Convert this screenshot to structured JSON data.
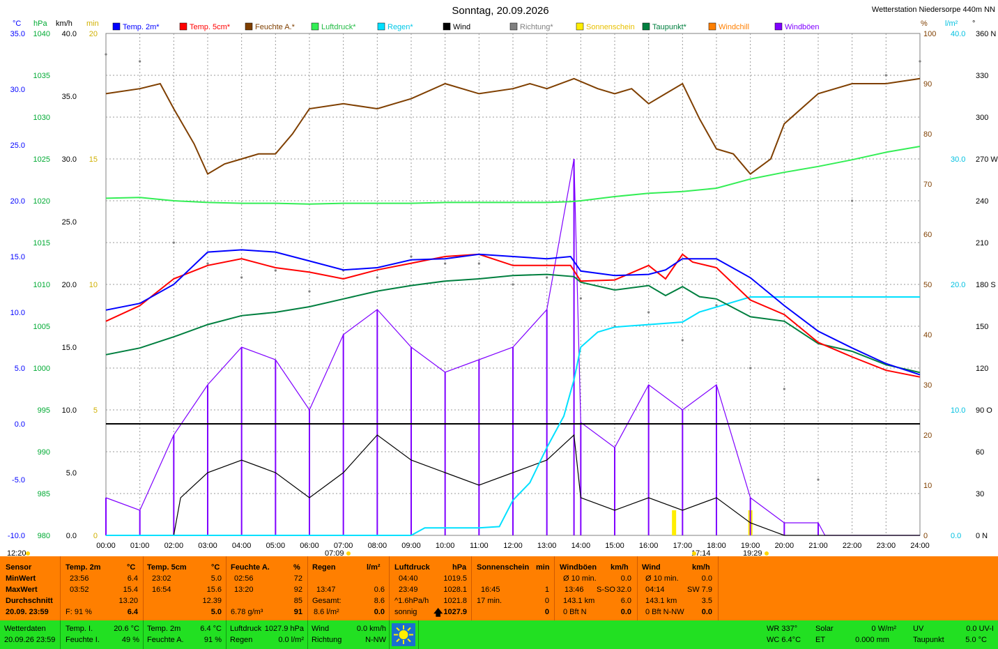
{
  "title": "Sonntag, 20.09.2026",
  "station": "Wetterstation Niedersorpe 440m NN",
  "legend": [
    {
      "label": "Temp. 2m*",
      "color": "#0000ff"
    },
    {
      "label": "Temp. 5cm*",
      "color": "#ff0000"
    },
    {
      "label": "Feuchte A.*",
      "color": "#7f3f00"
    },
    {
      "label": "Luftdruck*",
      "color": "#33ee55"
    },
    {
      "label": "Regen*",
      "color": "#00e0ff"
    },
    {
      "label": "Wind",
      "color": "#000000"
    },
    {
      "label": "Richtung*",
      "color": "#808080"
    },
    {
      "label": "Sonnenschein",
      "color": "#ffee00"
    },
    {
      "label": "Taupunkt*",
      "color": "#007f3f"
    },
    {
      "label": "Windchill",
      "color": "#ff7f00"
    },
    {
      "label": "Windböen",
      "color": "#7f00ff"
    }
  ],
  "units": {
    "temp": "°C",
    "pressure": "hPa",
    "wind": "km/h",
    "min": "min",
    "pct": "%",
    "rain": "l/m²",
    "deg": "°"
  },
  "sun_markers": {
    "rise_left": "12:20",
    "sunrise": "07:09",
    "transit": "17:14",
    "sunset": "19:29"
  },
  "chart_data": {
    "type": "line",
    "xlabel": "",
    "x_ticks": [
      "00:00",
      "01:00",
      "02:00",
      "03:00",
      "04:00",
      "05:00",
      "06:00",
      "07:00",
      "08:00",
      "09:00",
      "10:00",
      "11:00",
      "12:00",
      "13:00",
      "14:00",
      "15:00",
      "16:00",
      "17:00",
      "18:00",
      "19:00",
      "20:00",
      "21:00",
      "22:00",
      "23:00",
      "24:00"
    ],
    "axes": {
      "temp": {
        "unit": "°C",
        "range": [
          -10,
          35
        ],
        "ticks": [
          "35.0",
          "30.0",
          "25.0",
          "20.0",
          "15.0",
          "10.0",
          "5.0",
          "0.0",
          "-5.0",
          "-10.0"
        ],
        "color": "#0000ff"
      },
      "pressure": {
        "unit": "hPa",
        "range": [
          980,
          1040
        ],
        "ticks": [
          "1040",
          "1035",
          "1030",
          "1025",
          "1020",
          "1015",
          "1010",
          "1005",
          "1000",
          "995",
          "990",
          "985",
          "980"
        ],
        "color": "#00aa33"
      },
      "wind": {
        "unit": "km/h",
        "range": [
          0,
          40
        ],
        "ticks": [
          "40.0",
          "35.0",
          "30.0",
          "25.0",
          "20.0",
          "15.0",
          "10.0",
          "5.0",
          "0.0"
        ],
        "color": "#000000"
      },
      "sunmin": {
        "unit": "min",
        "range": [
          0,
          20
        ],
        "ticks": [
          "20",
          "15",
          "10",
          "5",
          "0"
        ],
        "color": "#d0b000"
      },
      "humidity": {
        "unit": "%",
        "range": [
          0,
          100
        ],
        "ticks": [
          "100",
          "90",
          "80",
          "70",
          "60",
          "50",
          "40",
          "30",
          "20",
          "10",
          "0"
        ],
        "color": "#7f3f00"
      },
      "rain": {
        "unit": "l/m²",
        "range": [
          0,
          40
        ],
        "ticks": [
          "40.0",
          "30.0",
          "20.0",
          "10.0",
          "0.0"
        ],
        "color": "#00c0e0"
      },
      "direction": {
        "unit": "°",
        "range": [
          0,
          360
        ],
        "ticks": [
          "360 N",
          "330",
          "300",
          "270 W",
          "240",
          "210",
          "180 S",
          "150",
          "120",
          "90 O",
          "60",
          "30",
          "0 N"
        ],
        "color": "#000000"
      }
    },
    "series": [
      {
        "name": "Temp. 2m*",
        "axis": "temp",
        "color": "#0000ff",
        "x": [
          0,
          1,
          2,
          3,
          4,
          5,
          6,
          7,
          8,
          9,
          10,
          11,
          12,
          13,
          13.7,
          14,
          15,
          16,
          16.5,
          17,
          18,
          19,
          20,
          21,
          22,
          23,
          24
        ],
        "y": [
          10.2,
          10.8,
          12.5,
          15.4,
          15.6,
          15.4,
          14.6,
          13.8,
          14.0,
          14.7,
          14.8,
          15.2,
          15.0,
          14.8,
          15.0,
          13.7,
          13.3,
          13.4,
          13.8,
          14.8,
          14.8,
          13.1,
          10.6,
          8.3,
          6.8,
          5.4,
          4.4
        ]
      },
      {
        "name": "Temp. 5cm*",
        "axis": "temp",
        "color": "#ff0000",
        "x": [
          0,
          1,
          2,
          3,
          4,
          5,
          6,
          7,
          8,
          9,
          10,
          11,
          12,
          13,
          13.7,
          14,
          15,
          16,
          16.5,
          17,
          17.3,
          18,
          19,
          20,
          21,
          22,
          23,
          24
        ],
        "y": [
          9.2,
          10.6,
          13.0,
          14.2,
          14.8,
          14.0,
          13.6,
          13.0,
          13.8,
          14.4,
          15.0,
          15.2,
          14.2,
          14.2,
          14.2,
          12.8,
          12.9,
          14.2,
          13.0,
          15.2,
          14.5,
          14.0,
          11.1,
          9.8,
          7.3,
          6.0,
          4.8,
          4.2
        ]
      },
      {
        "name": "Feuchte A.*",
        "axis": "humidity",
        "color": "#7f3f00",
        "x": [
          0,
          1,
          1.6,
          2,
          2.6,
          3,
          3.5,
          4,
          4.5,
          5,
          5.5,
          6,
          7,
          8,
          9,
          10,
          11,
          12,
          12.5,
          13,
          13.8,
          14.5,
          15,
          15.5,
          16,
          16.5,
          17,
          17.5,
          18,
          18.5,
          19,
          19.6,
          20,
          21,
          22,
          23,
          24
        ],
        "y": [
          88,
          89,
          90,
          85,
          78,
          72,
          74,
          75,
          76,
          76,
          80,
          85,
          86,
          85,
          87,
          90,
          88,
          89,
          90,
          89,
          91,
          89,
          88,
          89,
          86,
          88,
          90,
          83,
          77,
          76,
          72,
          75,
          82,
          88,
          90,
          90,
          91
        ]
      },
      {
        "name": "Luftdruck*",
        "axis": "pressure",
        "color": "#33ee55",
        "x": [
          0,
          1,
          2,
          3,
          4,
          5,
          6,
          7,
          8,
          9,
          10,
          11,
          12,
          13,
          13.7,
          14,
          15,
          16,
          17,
          18,
          19,
          20,
          21,
          22,
          23,
          24
        ],
        "y": [
          1020.3,
          1020.4,
          1020.0,
          1019.8,
          1019.7,
          1019.7,
          1019.6,
          1019.7,
          1019.7,
          1019.7,
          1019.8,
          1019.8,
          1019.8,
          1019.8,
          1019.9,
          1020.0,
          1020.5,
          1020.9,
          1021.1,
          1021.5,
          1022.6,
          1023.4,
          1024.1,
          1024.9,
          1025.8,
          1026.5
        ]
      },
      {
        "name": "Taupunkt*",
        "axis": "temp",
        "color": "#007f3f",
        "x": [
          0,
          1,
          2,
          3,
          4,
          5,
          6,
          7,
          8,
          9,
          10,
          11,
          12,
          13,
          13.8,
          14,
          15,
          16,
          16.5,
          17,
          17.5,
          18,
          19,
          20,
          21,
          22,
          23,
          24
        ],
        "y": [
          6.2,
          6.8,
          7.8,
          8.9,
          9.7,
          10.0,
          10.5,
          11.2,
          11.9,
          12.4,
          12.8,
          13.0,
          13.3,
          13.4,
          13.2,
          12.7,
          12.0,
          12.4,
          11.5,
          12.3,
          11.4,
          11.2,
          9.6,
          9.2,
          7.2,
          6.5,
          5.3,
          4.6
        ]
      },
      {
        "name": "Regen*",
        "axis": "rain",
        "color": "#00e0ff",
        "x": [
          0,
          9,
          9.4,
          10,
          11,
          11.6,
          12,
          12.5,
          13,
          13.5,
          13.8,
          14,
          14.5,
          15,
          16,
          17,
          17.5,
          18,
          19,
          24
        ],
        "y": [
          0,
          0,
          0.6,
          0.6,
          0.6,
          0.7,
          2.8,
          4.2,
          7.0,
          9.5,
          12.4,
          15.0,
          16.2,
          16.6,
          16.8,
          17.0,
          17.8,
          18.2,
          19.0,
          19.0
        ]
      },
      {
        "name": "Wind",
        "axis": "wind",
        "color": "#000000",
        "x": [
          0,
          2,
          2.2,
          3,
          4,
          5,
          6,
          7,
          8,
          9,
          10,
          11,
          12,
          13,
          13.8,
          14,
          15,
          16,
          17,
          18,
          19,
          20,
          24
        ],
        "y": [
          0,
          0,
          3,
          5,
          6,
          5,
          3,
          5,
          8,
          6,
          5,
          4,
          5,
          6,
          8,
          3,
          2,
          3,
          2,
          3,
          1,
          0,
          0
        ]
      },
      {
        "name": "Windböen",
        "axis": "wind",
        "color": "#7f00ff",
        "x": [
          0,
          1,
          2,
          3,
          4,
          5,
          6,
          7,
          8,
          9,
          10,
          11,
          12,
          13,
          13.8,
          14,
          15,
          16,
          17,
          18,
          19,
          20,
          21,
          21.2,
          24
        ],
        "y": [
          3,
          2,
          8,
          12,
          15,
          14,
          10,
          16,
          18,
          15,
          13,
          14,
          15,
          18,
          30,
          9,
          7,
          12,
          10,
          12,
          3,
          1,
          1,
          0,
          0
        ]
      },
      {
        "name": "Richtung*",
        "axis": "direction",
        "color": "#808080",
        "x": [
          0,
          1,
          2,
          3,
          4,
          5,
          6,
          7,
          8,
          9,
          10,
          11,
          12,
          13,
          14,
          15,
          16,
          17,
          18,
          19,
          20,
          21,
          22,
          23,
          24
        ],
        "y": [
          345,
          340,
          210,
          195,
          185,
          190,
          175,
          190,
          185,
          200,
          195,
          195,
          180,
          185,
          170,
          150,
          160,
          140,
          165,
          120,
          105,
          40,
          240,
          330,
          340
        ]
      },
      {
        "name": "Sonnenschein",
        "axis": "sunmin",
        "color": "#ffee00",
        "x": [
          16.75,
          19.0
        ],
        "y": [
          1,
          1
        ]
      }
    ]
  },
  "table": {
    "headers": [
      {
        "label": "Sensor",
        "unit": ""
      },
      {
        "label": "Temp. 2m",
        "unit": "°C"
      },
      {
        "label": "Temp. 5cm",
        "unit": "°C"
      },
      {
        "label": "Feuchte A.",
        "unit": "%"
      },
      {
        "label": "Regen",
        "unit": "l/m²"
      },
      {
        "label": "Luftdruck",
        "unit": "hPa"
      },
      {
        "label": "Sonnenschein",
        "unit": "min"
      },
      {
        "label": "Windböen",
        "unit": "km/h"
      },
      {
        "label": "Wind",
        "unit": "km/h"
      }
    ],
    "row_labels": [
      "MinWert",
      "MaxWert",
      "Durchschnitt",
      "20.09. 23:59"
    ],
    "temp2m": {
      "min_t": "23:56",
      "min": "6.4",
      "max_t": "03:52",
      "max": "15.4",
      "avg": "13.20",
      "cur_f": "F: 91 %",
      "cur": "6.4"
    },
    "temp5cm": {
      "min_t": "23:02",
      "min": "5.0",
      "max_t": "16:54",
      "max": "15.6",
      "avg": "12.39",
      "cur": "5.0"
    },
    "humid": {
      "min_t": "02:56",
      "min": "72",
      "max_t": "13:20",
      "max": "92",
      "avg": "85",
      "abs": "6.78 g/m³",
      "cur": "91"
    },
    "rain": {
      "max_t": "13:47",
      "max": "0.6",
      "total_label": "Gesamt:",
      "total": "8.6",
      "cur_l": "8.6 l/m²",
      "cur": "0.0"
    },
    "press": {
      "min_t": "04:40",
      "min": "1019.5",
      "max_t": "23:49",
      "max": "1028.1",
      "trend": "^1.6hPa/h",
      "avg": "1021.8",
      "state": "sonnig",
      "cur": "1027.9",
      "arrow": "🡅"
    },
    "sun": {
      "t": "16:45",
      "val": "1",
      "total": "17 min.",
      "total_v": "0",
      "cur": "0"
    },
    "gust": {
      "avg_l": "Ø 10 min.",
      "avg": "0.0",
      "max_t": "13:46",
      "max_dir": "S-SO",
      "max": "32.0",
      "dist": "143.1 km",
      "dist_v": "6.0",
      "bft": "0 Bft N",
      "cur": "0.0"
    },
    "wind": {
      "avg_l": "Ø 10 min.",
      "avg": "0.0",
      "max_t": "04:14",
      "max_dir": "SW",
      "max": "7.9",
      "dist": "143.1 km",
      "dist_v": "3.5",
      "bft": "0 Bft N-NW",
      "cur": "0.0"
    }
  },
  "status": {
    "label": "Wetterdaten",
    "datetime": "20.09.26 23:59",
    "temp_i_l": "Temp. I.",
    "temp_i": "20.6 °C",
    "feuchte_i_l": "Feuchte I.",
    "feuchte_i": "49 %",
    "temp2m_l": "Temp. 2m",
    "temp2m": "6.4 °C",
    "feuchte_a_l": "Feuchte A.",
    "feuchte_a": "91 %",
    "luft_l": "Luftdruck",
    "luft": "1027.9 hPa",
    "regen_l": "Regen",
    "regen": "0.0 l/m²",
    "wind_l": "Wind",
    "wind": "0.0 km/h",
    "richtung_l": "Richtung",
    "richtung": "N-NW",
    "wr": "WR 337°",
    "wc": "WC 6.4°C",
    "solar_l": "Solar",
    "solar": "0 W/m²",
    "et_l": "ET",
    "et": "0.000 mm",
    "uv_l": "UV",
    "uv": "0.0 UV-I",
    "tp_l": "Taupunkt",
    "tp": "5.0 °C"
  }
}
